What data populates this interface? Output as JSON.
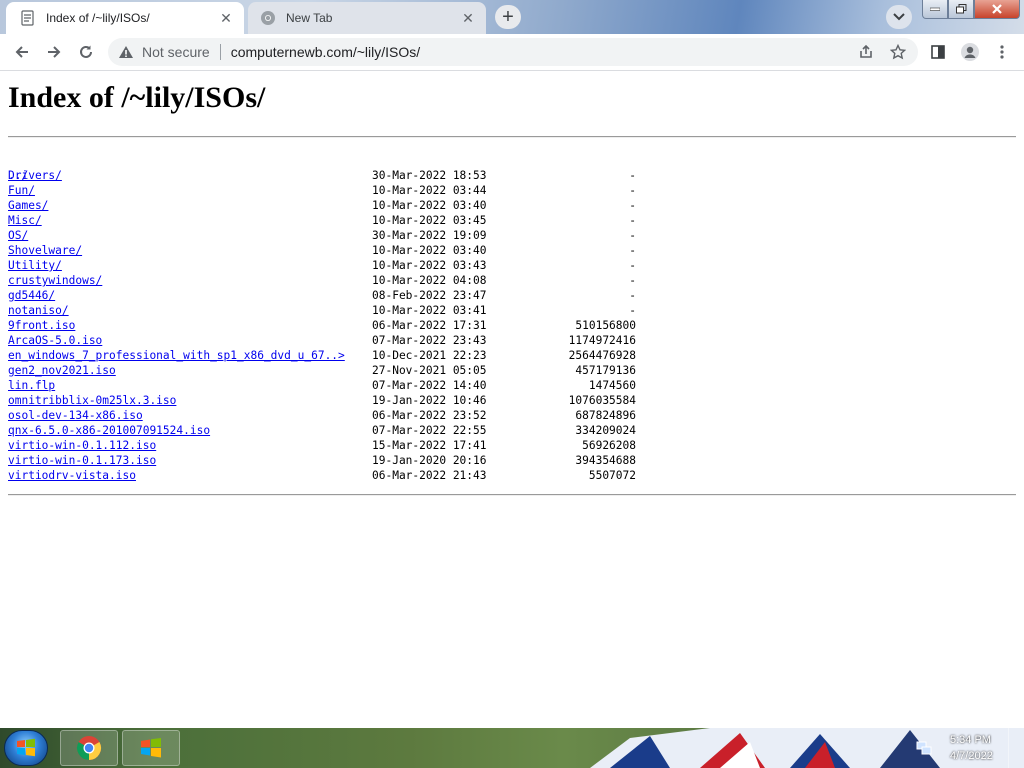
{
  "browser": {
    "tabs": [
      {
        "title": "Index of /~lily/ISOs/",
        "active": true,
        "icon": "page-favicon"
      },
      {
        "title": "New Tab",
        "active": false,
        "icon": "chrome-favicon"
      }
    ],
    "security_label": "Not secure",
    "url": "computernewb.com/~lily/ISOs/"
  },
  "page": {
    "heading": "Index of /~lily/ISOs/",
    "parent_link": "../",
    "entries": [
      {
        "name": "Drivers/",
        "date": "30-Mar-2022 18:53",
        "size": "-"
      },
      {
        "name": "Fun/",
        "date": "10-Mar-2022 03:44",
        "size": "-"
      },
      {
        "name": "Games/",
        "date": "10-Mar-2022 03:40",
        "size": "-"
      },
      {
        "name": "Misc/",
        "date": "10-Mar-2022 03:45",
        "size": "-"
      },
      {
        "name": "OS/",
        "date": "30-Mar-2022 19:09",
        "size": "-"
      },
      {
        "name": "Shovelware/",
        "date": "10-Mar-2022 03:40",
        "size": "-"
      },
      {
        "name": "Utility/",
        "date": "10-Mar-2022 03:43",
        "size": "-"
      },
      {
        "name": "crustywindows/",
        "date": "10-Mar-2022 04:08",
        "size": "-"
      },
      {
        "name": "gd5446/",
        "date": "08-Feb-2022 23:47",
        "size": "-"
      },
      {
        "name": "notaniso/",
        "date": "10-Mar-2022 03:41",
        "size": "-"
      },
      {
        "name": "9front.iso",
        "date": "06-Mar-2022 17:31",
        "size": "510156800"
      },
      {
        "name": "ArcaOS-5.0.iso",
        "date": "07-Mar-2022 23:43",
        "size": "1174972416"
      },
      {
        "name": "en_windows_7_professional_with_sp1_x86_dvd_u_67..>",
        "date": "10-Dec-2021 22:23",
        "size": "2564476928"
      },
      {
        "name": "gen2_nov2021.iso",
        "date": "27-Nov-2021 05:05",
        "size": "457179136"
      },
      {
        "name": "lin.flp",
        "date": "07-Mar-2022 14:40",
        "size": "1474560"
      },
      {
        "name": "omnitribblix-0m25lx.3.iso",
        "date": "19-Jan-2022 10:46",
        "size": "1076035584"
      },
      {
        "name": "osol-dev-134-x86.iso",
        "date": "06-Mar-2022 23:52",
        "size": "687824896"
      },
      {
        "name": "qnx-6.5.0-x86-201007091524.iso",
        "date": "07-Mar-2022 22:55",
        "size": "334209024"
      },
      {
        "name": "virtio-win-0.1.112.iso",
        "date": "15-Mar-2022 17:41",
        "size": "56926208"
      },
      {
        "name": "virtio-win-0.1.173.iso",
        "date": "19-Jan-2020 20:16",
        "size": "394354688"
      },
      {
        "name": "virtiodrv-vista.iso",
        "date": "06-Mar-2022 21:43",
        "size": "5507072"
      }
    ]
  },
  "taskbar": {
    "clock_time": "5:34 PM",
    "clock_date": "4/7/2022",
    "pinned": [
      "chrome-icon",
      "windows-explorer-icon"
    ]
  },
  "colors": {
    "link": "#0000ee",
    "chrome_tab_inactive": "#dfe3ea",
    "omnibox": "#f1f3f4"
  }
}
